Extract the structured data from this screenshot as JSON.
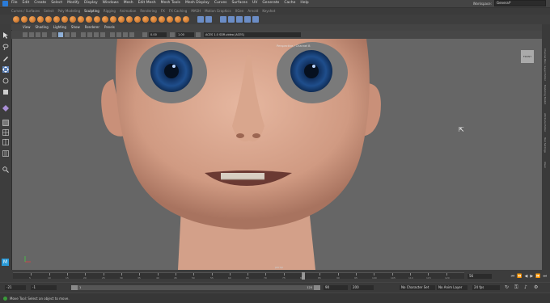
{
  "menubar": {
    "items": [
      "File",
      "Edit",
      "Create",
      "Select",
      "Modify",
      "Display",
      "Windows",
      "Mesh",
      "Edit Mesh",
      "Mesh Tools",
      "Mesh Display",
      "Curves",
      "Surfaces",
      "UV",
      "Generate",
      "Cache",
      "Help"
    ],
    "workspace_label": "Workspace:",
    "workspace_value": "General*"
  },
  "shelf_tabs": {
    "items": [
      "Curves / Surfaces",
      "Select",
      "Poly Modeling",
      "Sculpting",
      "Rigging",
      "Animation",
      "Rendering",
      "FX",
      "FX Caching",
      "MASH",
      "Motion Graphics",
      "XGen",
      "Arnold",
      "Keyshot"
    ],
    "active_index": 3
  },
  "panel_menu": {
    "items": [
      "View",
      "Shading",
      "Lighting",
      "Show",
      "Renderer",
      "Panels"
    ]
  },
  "panel_toolbar": {
    "exposure": "0.00",
    "gamma": "1.00",
    "colorspace": "ACES 1.0 SDR-video (ACES)"
  },
  "viewport": {
    "camera_label": "Perspective / Channel B",
    "view_name": "persp",
    "viewcube_label": "FRONT"
  },
  "right_tabs": [
    "Channel Box / Layer Editor",
    "Modeling Toolkit",
    "Attribute Editor",
    "Tool Settings",
    "XGen"
  ],
  "timeline": {
    "current_frame": "56",
    "ticks": [
      "5",
      "10",
      "15",
      "20",
      "25",
      "30",
      "35",
      "40",
      "45",
      "50",
      "55",
      "60",
      "65",
      "70",
      "75",
      "80",
      "85",
      "90",
      "95",
      "100",
      "105",
      "110",
      "115",
      "120"
    ]
  },
  "range": {
    "start": "-21",
    "inner_start": "-1",
    "slider_start": "1",
    "slider_end": "120",
    "inner_end": "90",
    "end": "200",
    "character_set": "No Character Set",
    "anim_layer": "No Anim Layer",
    "fps": "24 fps"
  },
  "helpline": {
    "text": "Move Tool: Select an object to move."
  },
  "colors": {
    "accent": "#5a7fb5",
    "viewport_bg": "#666666",
    "skin": "#d9a78f",
    "iris": "#1f4e8c",
    "shelf_icon": "#e08a3a"
  }
}
